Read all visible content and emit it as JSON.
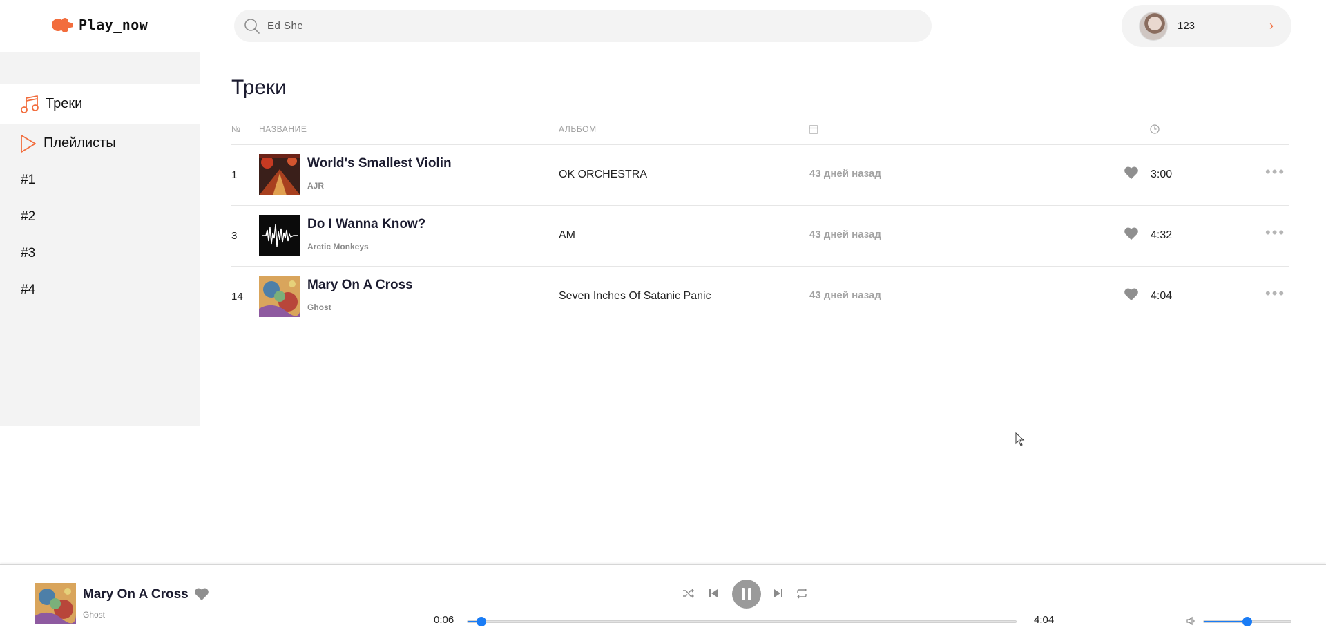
{
  "app": {
    "logo_text": "Play_now",
    "accent": "#f26d3d",
    "progress_blue": "#1a7cf5"
  },
  "search": {
    "value": "Ed She"
  },
  "profile": {
    "name": "123"
  },
  "sidebar": {
    "items": [
      {
        "label": "Треки",
        "icon": "music-note-icon",
        "active": true
      },
      {
        "label": "Плейлисты",
        "icon": "play-triangle-icon",
        "active": false
      }
    ],
    "playlists": [
      "#1",
      "#2",
      "#3",
      "#4"
    ]
  },
  "main": {
    "title": "Треки",
    "columns": {
      "num": "№",
      "name": "НАЗВАНИЕ",
      "album": "АЛЬБОМ",
      "date_icon": "calendar-icon",
      "duration_icon": "clock-icon"
    },
    "tracks": [
      {
        "num": "1",
        "title": "World's Smallest Violin",
        "artist": "AJR",
        "album": "OK ORCHESTRA",
        "added": "43 дней назад",
        "duration": "3:00",
        "liked": true
      },
      {
        "num": "3",
        "title": "Do I Wanna Know?",
        "artist": "Arctic Monkeys",
        "album": "AM",
        "added": "43 дней назад",
        "duration": "4:32",
        "liked": true
      },
      {
        "num": "14",
        "title": "Mary On A Cross",
        "artist": "Ghost",
        "album": "Seven Inches Of Satanic Panic",
        "added": "43 дней назад",
        "duration": "4:04",
        "liked": true
      }
    ]
  },
  "player": {
    "title": "Mary On A Cross",
    "artist": "Ghost",
    "current_time": "0:06",
    "total_time": "4:04",
    "progress": 0.025,
    "volume": 0.5,
    "state": "playing"
  }
}
